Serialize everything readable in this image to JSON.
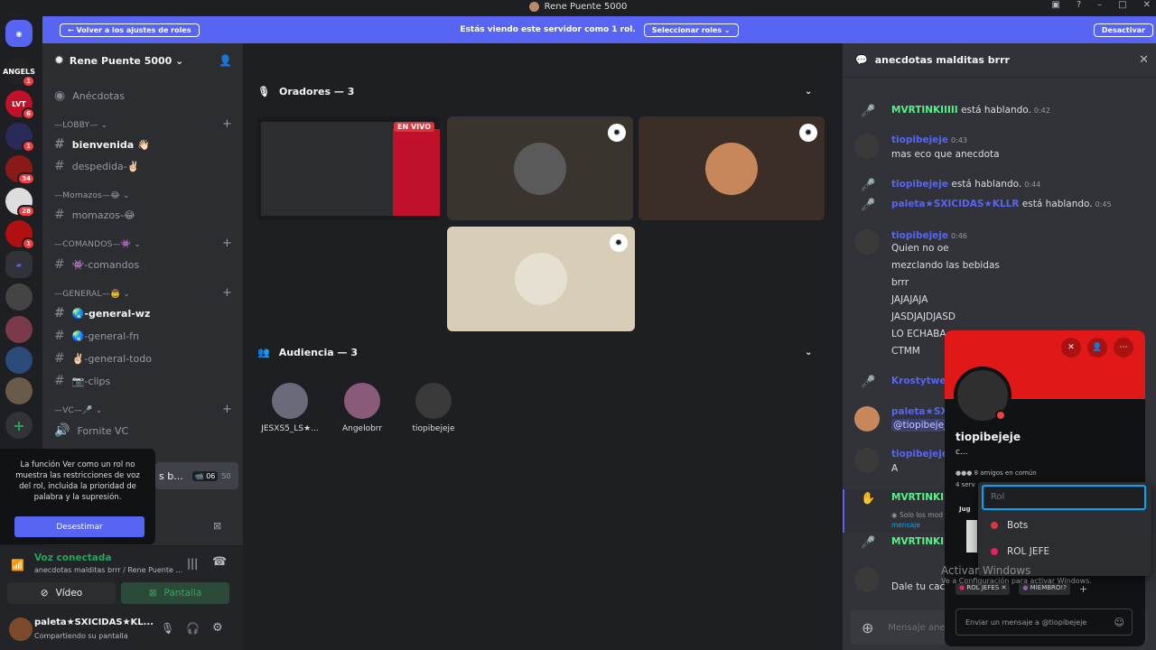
{
  "window": {
    "title": "Rene Puente 5000"
  },
  "notice": {
    "back_label": "Volver a los ajustes de roles",
    "text": "Estás viendo este servidor como 1 rol.",
    "select_label": "Seleccionar roles",
    "deactivate_label": "Desactivar"
  },
  "guilds": [
    {
      "label": "ANGELS",
      "badge": "1",
      "color": "#222"
    },
    {
      "label": "LVT",
      "badge": "6",
      "color": "#c0102a"
    },
    {
      "label": "",
      "badge": "1",
      "color": "#2a2a5a"
    },
    {
      "label": "",
      "badge": "34",
      "color": "#8a1a1a"
    },
    {
      "label": "",
      "badge": "28",
      "color": "#ddd"
    },
    {
      "label": "",
      "badge": "1",
      "color": "#b01010"
    }
  ],
  "server": {
    "name": "Rene Puente 5000"
  },
  "channels": {
    "anecdotas": "Anécdotas",
    "cat_lobby": "—LOBBY—",
    "bienvenida": "bienvenida 👋🏻",
    "despedida": "despedida-✌🏻",
    "cat_momazos": "—Momazos—😂",
    "momazos": "momazos-😂",
    "cat_comandos": "—COMANDOS—👾",
    "comandos": "👾-comandos",
    "cat_general": "—GENERAL—🤠",
    "general_wz": "🌏-general-wz",
    "general_fn": "🌏-general-fn",
    "general_todo": "✌🏻-general-todo",
    "clips": "📷-clips",
    "cat_vc": "—VC—🎤",
    "fornite_vc": "Fornite VC",
    "active_vc": "s b...",
    "active_vc_count": "06",
    "active_vc_limit": "50"
  },
  "tooltip": {
    "text": "La función Ver como un rol no muestra las restricciones de voz del rol, incluida la prioridad de palabra y la supresión.",
    "dismiss_label": "Desestimar"
  },
  "voice": {
    "status": "Voz conectada",
    "location": "anecdotas malditas brrr / Rene Puente ...",
    "video_label": "Vídeo",
    "screen_label": "Pantalla"
  },
  "user": {
    "name": "paleta★SXICIDAS★KL...",
    "status": "Compartiendo su pantalla"
  },
  "stage": {
    "speakers_label": "Oradores — 3",
    "live_label": "EN VIVO",
    "audience_label": "Audiencia — 3",
    "audience": [
      {
        "name": "JESXS5_LS★...",
        "color": "#6a6a7a"
      },
      {
        "name": "Angelobrr",
        "color": "#8a5a7a"
      },
      {
        "name": "tiopibejeje",
        "color": "#3a3a3a"
      }
    ]
  },
  "chat": {
    "channel": "anecdotas malditas brrr",
    "messages": {
      "m1_name": "MVRTINKIIIII",
      "m1_text": "está hablando.",
      "m1_ts": "0:42",
      "m2_name": "tiopibejeje",
      "m2_ts": "0:43",
      "m2_text": "mas eco que anecdota",
      "m3_name": "tiopibejeje",
      "m3_text": "está hablando.",
      "m3_ts": "0:44",
      "m4_name": "paleta★SXICIDAS★KLLR",
      "m4_text": "está hablando.",
      "m4_ts": "0:45",
      "m5_name": "tiopibejeje",
      "m5_ts": "0:46",
      "m5_lines": [
        "Quien no oe",
        "mezclando las bebidas",
        "brrr",
        "JAJAJAJA",
        "JASDJAJDJASD",
        "LO ECHABA",
        "CTMM"
      ],
      "m6_name": "Krostytwen",
      "m7_name": "paleta★SXI",
      "m7_mention": "@tiopibejeje",
      "m8_name": "tiopibejeje",
      "m8_text": "A",
      "m9_name": "MVRTINKIIII",
      "m9_note": "Solo los mod",
      "m9_note2": "mensaje",
      "m10_name": "MVRTINKIIII",
      "m11_text": "Dale tu cacl"
    },
    "input_placeholder": "Mensaje ane"
  },
  "profile": {
    "username": "tiopibejeje",
    "sub": "c...",
    "mutual": "8 amigos en común",
    "servers": "4 serv",
    "section": "Jug",
    "roles": [
      "ROL JEFES",
      "MIEMBRO!?"
    ],
    "dm_placeholder": "Enviar un mensaje a @tiopibejeje"
  },
  "role_picker": {
    "placeholder": "Rol",
    "items": [
      {
        "label": "Bots",
        "color": "#da373c"
      },
      {
        "label": "ROL JEFE",
        "color": "#e91e63"
      }
    ]
  },
  "watermark": {
    "text": "Activar Windows",
    "sub": "Ve a Configuración para activar Windows."
  }
}
